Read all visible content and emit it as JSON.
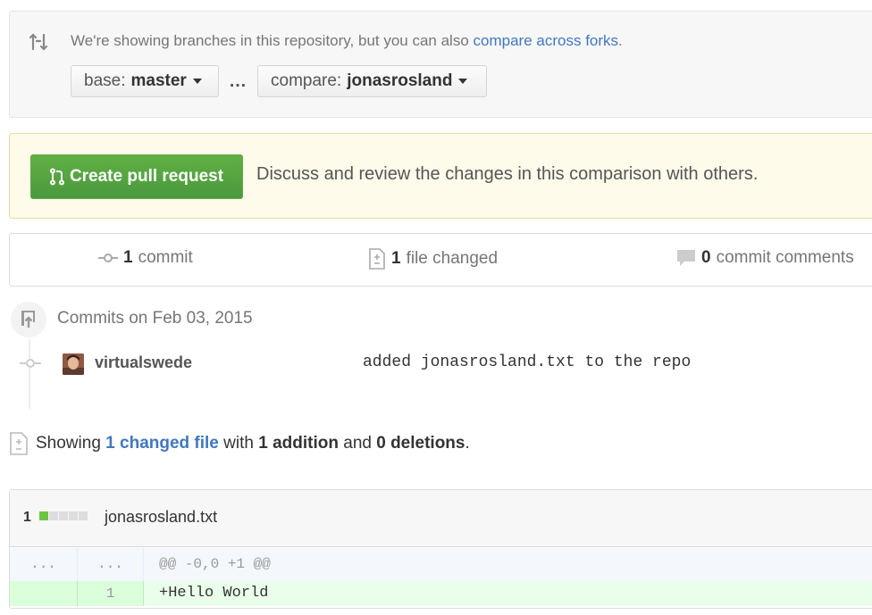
{
  "range": {
    "intro": "We're showing branches in this repository, but you can also ",
    "forks_link": "compare across forks",
    "period": ".",
    "base_prefix": "base:",
    "base_value": "master",
    "separator": "…",
    "compare_prefix": "compare:",
    "compare_value": "jonasrosland"
  },
  "flash": {
    "button_label": "Create pull request",
    "text": "Discuss and review the changes in this comparison with others."
  },
  "summary": {
    "commits_count": "1",
    "commits_label": "commit",
    "files_count": "1",
    "files_label": "file changed",
    "comments_count": "0",
    "comments_label": "commit comments"
  },
  "commits": {
    "group_title": "Commits on Feb 03, 2015",
    "items": [
      {
        "author": "virtualswede",
        "message": "added jonasrosland.txt to the repo"
      }
    ]
  },
  "showing": {
    "prefix": "Showing ",
    "link": "1 changed file",
    "mid": " with ",
    "additions": "1 addition",
    "and": " and ",
    "deletions": "0 deletions",
    "end": "."
  },
  "file": {
    "changes": "1",
    "name": "jonasrosland.txt",
    "hunk_left": "...",
    "hunk_right": "...",
    "hunk_header": "@@ -0,0 +1 @@",
    "lines": [
      {
        "old_num": "",
        "new_num": "1",
        "text": "+Hello World"
      }
    ]
  },
  "colors": {
    "link": "#4078c0",
    "primary_green": "#55a532",
    "flash_bg": "#fffbeb",
    "addition_bg": "#eaffea"
  }
}
